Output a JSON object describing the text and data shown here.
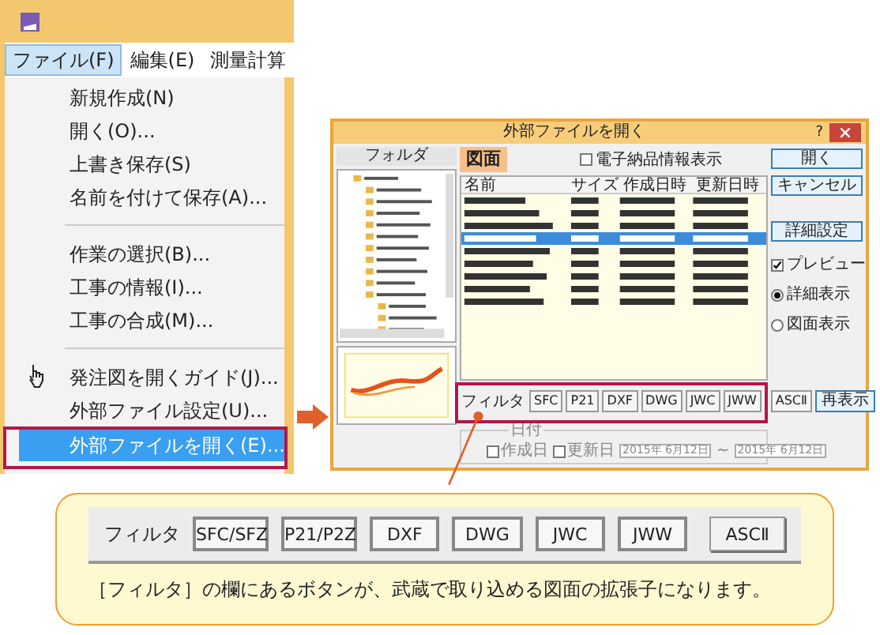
{
  "menu_window": {
    "menubar": [
      {
        "label": "ファイル(F)",
        "selected": true
      },
      {
        "label": "編集(E)",
        "selected": false
      },
      {
        "label": "測量計算",
        "selected": false
      }
    ],
    "items": [
      {
        "kind": "item",
        "label": "新規作成(N)",
        "selected": false
      },
      {
        "kind": "item",
        "label": "開く(O)...",
        "selected": false
      },
      {
        "kind": "item",
        "label": "上書き保存(S)",
        "selected": false
      },
      {
        "kind": "item",
        "label": "名前を付けて保存(A)...",
        "selected": false
      },
      {
        "kind": "separator"
      },
      {
        "kind": "item",
        "label": "作業の選択(B)...",
        "selected": false
      },
      {
        "kind": "item",
        "label": "工事の情報(I)...",
        "selected": false
      },
      {
        "kind": "item",
        "label": "工事の合成(M)...",
        "selected": false
      },
      {
        "kind": "separator"
      },
      {
        "kind": "hand-item",
        "label": "発注図を開くガイド(J)...",
        "selected": false
      },
      {
        "kind": "item",
        "label": "外部ファイル設定(U)...",
        "selected": false
      },
      {
        "kind": "item",
        "label": "外部ファイルを開く(E)...",
        "selected": true
      }
    ]
  },
  "dialog": {
    "title": "外部ファイルを開く",
    "help": "?",
    "folder_header": "フォルダ",
    "tab": "図面",
    "e_delivery": {
      "label": "電子納品情報表示",
      "checked": false
    },
    "columns": [
      "名前",
      "サイズ",
      "作成日時",
      "更新日時"
    ],
    "file_rows": [
      {
        "selected": false
      },
      {
        "selected": false
      },
      {
        "selected": false
      },
      {
        "selected": true
      },
      {
        "selected": false
      },
      {
        "selected": false
      },
      {
        "selected": false
      },
      {
        "selected": false
      },
      {
        "selected": false
      }
    ],
    "buttons": [
      "開く",
      "キャンセル"
    ],
    "detail_button": "詳細設定",
    "preview": {
      "label": "プレビュー",
      "checked": true
    },
    "view_options": [
      {
        "label": "詳細表示",
        "selected": true
      },
      {
        "label": "図面表示",
        "selected": false
      }
    ],
    "filter_label": "フィルタ",
    "filter_buttons": [
      "SFC",
      "P21",
      "DXF",
      "DWG",
      "JWC",
      "JWW"
    ],
    "ascii_button": "ASCⅡ",
    "refresh_button": "再表示",
    "date_group": "日付",
    "date_checks": [
      {
        "label": "作成日",
        "checked": false
      },
      {
        "label": "更新日",
        "checked": false
      }
    ],
    "date_from": "2015年 6月12日",
    "date_sep": "~",
    "date_to": "2015年 6月12日"
  },
  "callout": {
    "filter_label": "フィルタ",
    "buttons": [
      "SFC/SFZ",
      "P21/P2Z",
      "DXF",
      "DWG",
      "JWC",
      "JWW"
    ],
    "ascii_button": "ASCⅡ",
    "note": "［フィルタ］の欄にあるボタンが、武蔵で取り込める図面の拡張子になります。"
  }
}
